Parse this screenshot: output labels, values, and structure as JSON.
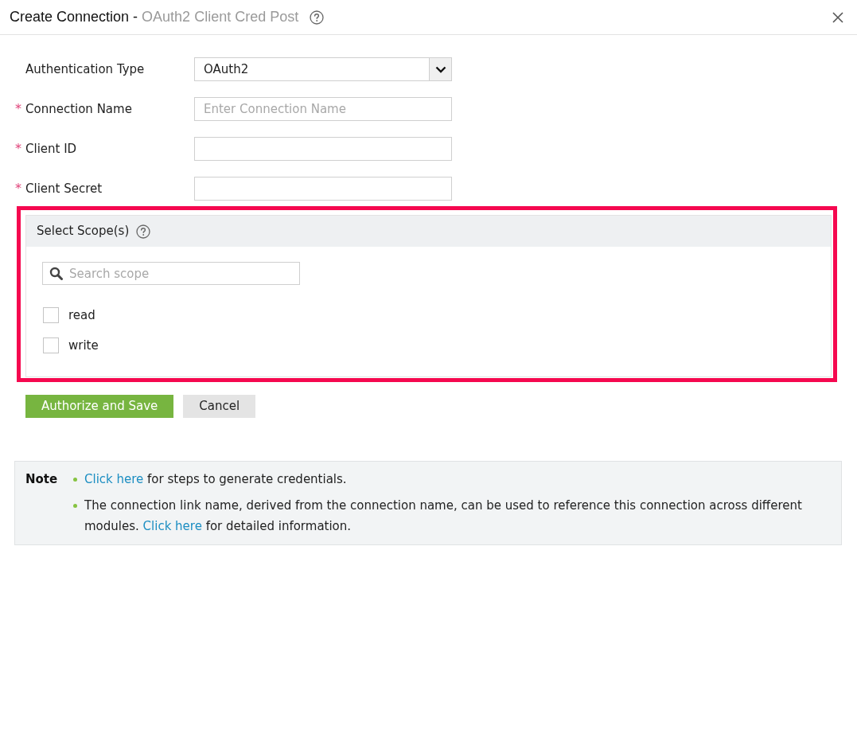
{
  "dialog": {
    "title": "Create Connection -",
    "subtitle": "OAuth2 Client Cred Post"
  },
  "form": {
    "fields": [
      {
        "kind": "select",
        "label": "Authentication Type",
        "value": "OAuth2"
      },
      {
        "kind": "text",
        "marker": "*",
        "label": "Connection Name",
        "placeholder": "Enter Connection Name"
      },
      {
        "kind": "text",
        "marker": "*",
        "label": "Client ID"
      },
      {
        "kind": "text",
        "marker": "*",
        "label": "Client Secret"
      }
    ]
  },
  "scopes": {
    "highlighted": true,
    "title": "Select Scope(s)",
    "search": {
      "placeholder": "Search scope"
    },
    "items": [
      {
        "label": "read",
        "checked": false
      },
      {
        "label": "write",
        "checked": false
      }
    ]
  },
  "buttons": [
    {
      "kind": "primary",
      "label": "Authorize and Save"
    },
    {
      "kind": "secondary",
      "label": "Cancel"
    }
  ],
  "note": {
    "label": "Note",
    "items": [
      {
        "parts": [
          {
            "kind": "link",
            "text": "Click here"
          },
          {
            "kind": "text",
            "text": " for steps to generate credentials."
          }
        ]
      },
      {
        "parts": [
          {
            "kind": "text",
            "text": "The connection link name, derived from the connection name, can be used to reference this connection across different modules. "
          },
          {
            "kind": "link",
            "text": "Click here"
          },
          {
            "kind": "text",
            "text": " for detailed information."
          }
        ]
      }
    ]
  }
}
